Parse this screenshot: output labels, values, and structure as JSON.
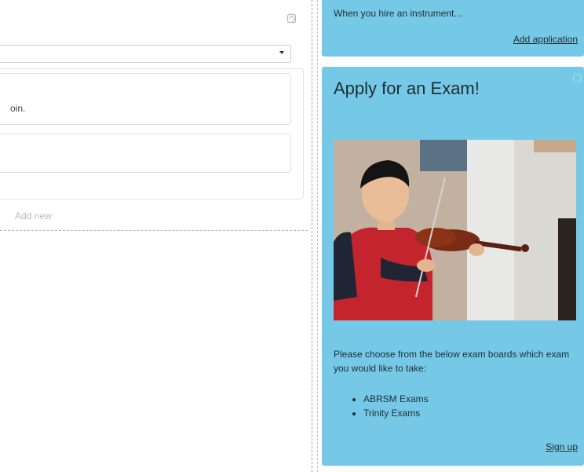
{
  "left_panel": {
    "settings_icon": "refresh-icon",
    "select": {
      "value": ""
    },
    "field1_text": "oin.",
    "add_new_label": "Add new"
  },
  "hire_card": {
    "text": "When you hire an instrument...",
    "link_label": "Add application"
  },
  "exam_card": {
    "title": "Apply for an Exam!",
    "settings_icon": "refresh-icon",
    "image_alt": "Boy playing violin",
    "intro": "Please choose from the below exam boards which exam you would like to take:",
    "exam_boards": [
      "ABRSM Exams",
      "Trinity Exams"
    ],
    "link_label": "Sign up"
  },
  "colors": {
    "card_bg": "#76c9e6",
    "card_text": "#1d2d33",
    "muted_text": "#b9b9b9"
  }
}
